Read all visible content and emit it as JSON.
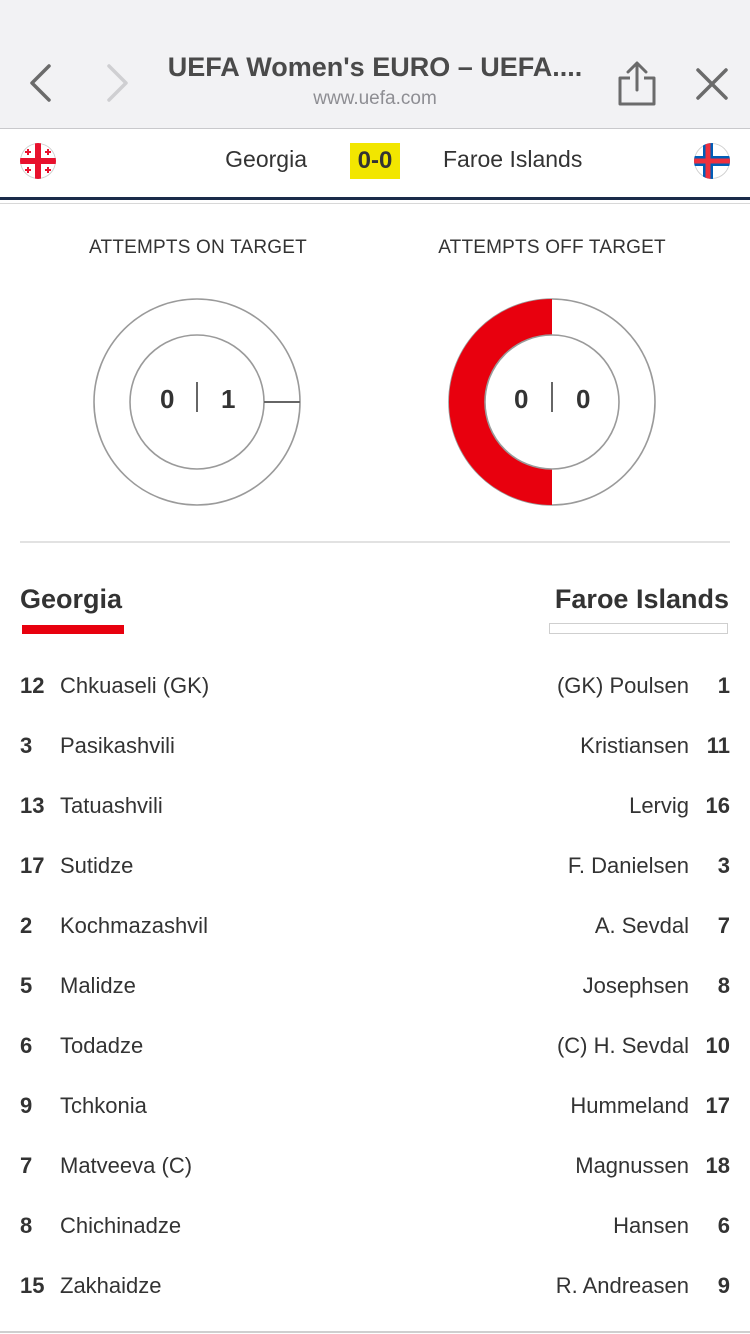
{
  "browser": {
    "title": "UEFA Women's EURO – UEFA....",
    "url": "www.uefa.com",
    "icons": {
      "back": "chevron-left-icon",
      "forward": "chevron-right-icon",
      "share": "share-icon",
      "close": "close-icon"
    }
  },
  "match": {
    "home_team": "Georgia",
    "away_team": "Faroe Islands",
    "score": "0-0",
    "score_highlight_color": "#f2e600"
  },
  "stats": {
    "on_target": {
      "title": "ATTEMPTS ON TARGET",
      "home": "0",
      "away": "1"
    },
    "off_target": {
      "title": "ATTEMPTS OFF TARGET",
      "home": "0",
      "away": "0"
    },
    "home_color": "#e8000e"
  },
  "lineups": {
    "home_team": "Georgia",
    "away_team": "Faroe Islands",
    "home_color": "#e8000e",
    "home": [
      {
        "num": "12",
        "name": "Chkuaseli (GK)"
      },
      {
        "num": "3",
        "name": "Pasikashvili"
      },
      {
        "num": "13",
        "name": "Tatuashvili"
      },
      {
        "num": "17",
        "name": "Sutidze"
      },
      {
        "num": "2",
        "name": "Kochmazashvil"
      },
      {
        "num": "5",
        "name": "Malidze"
      },
      {
        "num": "6",
        "name": "Todadze"
      },
      {
        "num": "9",
        "name": "Tchkonia"
      },
      {
        "num": "7",
        "name": "Matveeva (C)"
      },
      {
        "num": "8",
        "name": "Chichinadze"
      },
      {
        "num": "15",
        "name": "Zakhaidze"
      }
    ],
    "away": [
      {
        "num": "1",
        "name": "(GK) Poulsen"
      },
      {
        "num": "11",
        "name": "Kristiansen"
      },
      {
        "num": "16",
        "name": "Lervig"
      },
      {
        "num": "3",
        "name": "F. Danielsen"
      },
      {
        "num": "7",
        "name": "A. Sevdal"
      },
      {
        "num": "8",
        "name": "Josephsen"
      },
      {
        "num": "10",
        "name": "(C) H. Sevdal"
      },
      {
        "num": "17",
        "name": "Hummeland"
      },
      {
        "num": "18",
        "name": "Magnussen"
      },
      {
        "num": "6",
        "name": "Hansen"
      },
      {
        "num": "9",
        "name": "R. Andreasen"
      }
    ]
  }
}
